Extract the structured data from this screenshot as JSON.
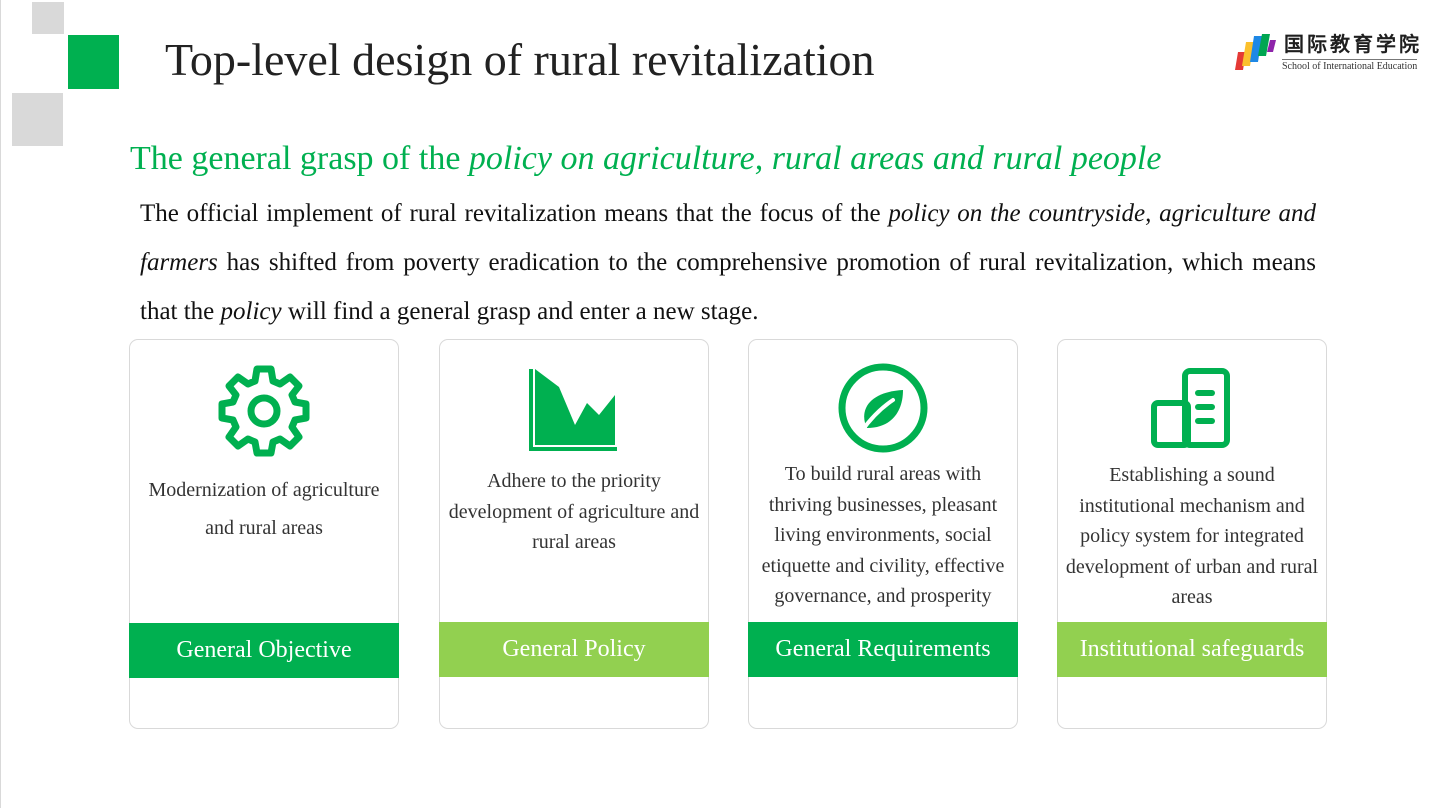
{
  "title": "Top-level design of rural revitalization",
  "logo": {
    "chinese": "国际教育学院",
    "english": "School of International Education"
  },
  "subtitle": {
    "plain": "The general grasp of the ",
    "italic": "policy on agriculture, rural areas and rural people"
  },
  "paragraph": {
    "p1": "The official implement of rural revitalization means that the focus of the ",
    "i1": "policy on the countryside, agriculture and farmers",
    "p2": " has shifted from poverty eradication to the comprehensive promotion of rural revitalization, which means that the ",
    "i2": "policy",
    "p3": " will find a general grasp and enter a new stage."
  },
  "cards": [
    {
      "icon": "gear-icon",
      "description": "Modernization of agriculture and rural areas",
      "label": "General Objective",
      "band_color": "#00b050"
    },
    {
      "icon": "area-chart-icon",
      "description": "Adhere to the priority development of agriculture and rural areas",
      "label": "General Policy",
      "band_color": "#92d050"
    },
    {
      "icon": "leaf-icon",
      "description": "To build rural areas with thriving businesses, pleasant living environments, social etiquette and civility, effective governance, and prosperity",
      "label": "General Requirements",
      "band_color": "#00b050"
    },
    {
      "icon": "buildings-icon",
      "description": "Establishing a sound institutional mechanism and policy system for integrated development of urban and rural areas",
      "label": "Institutional safeguards",
      "band_color": "#92d050"
    }
  ],
  "colors": {
    "accent_green": "#00b050",
    "light_green": "#92d050",
    "deco_gray": "#d9d9d9"
  }
}
